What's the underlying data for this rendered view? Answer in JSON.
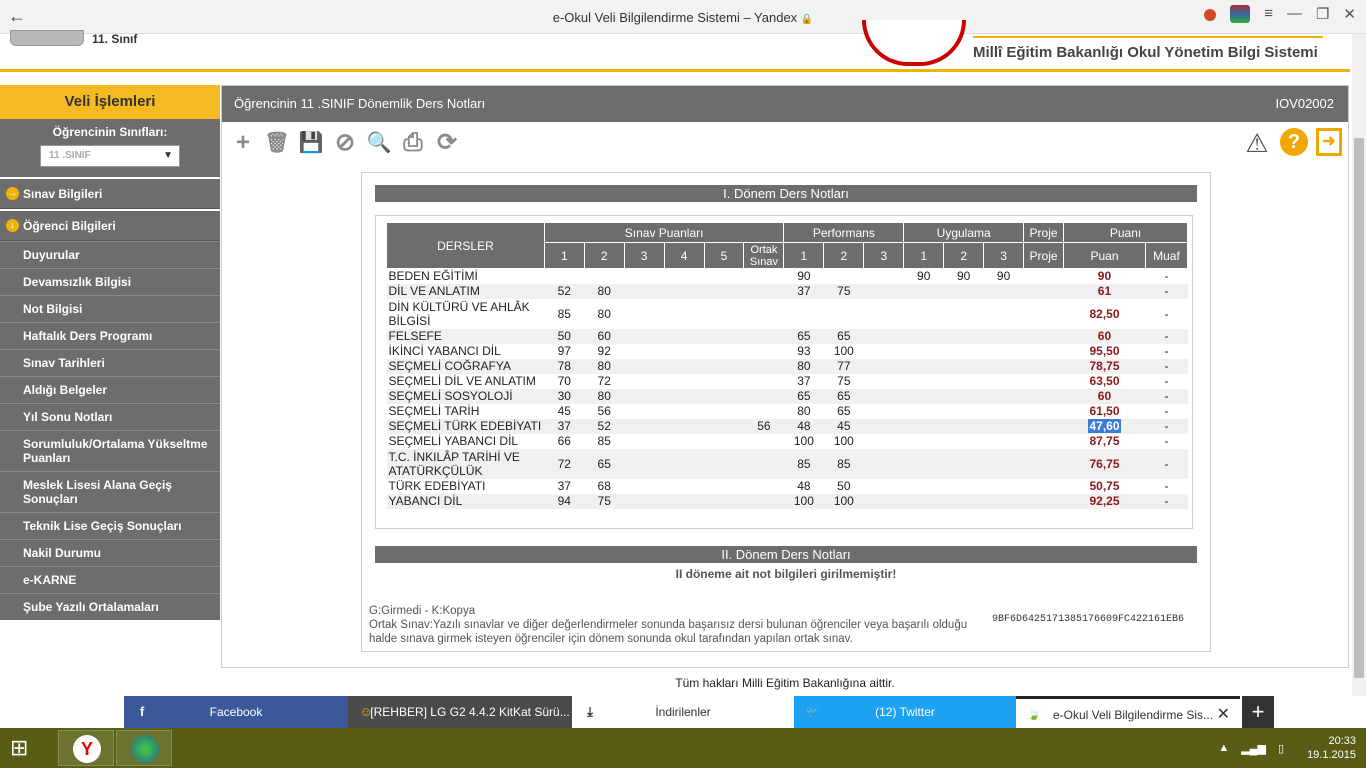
{
  "browser": {
    "back_icon": "←",
    "title": "e-Okul Veli Bilgilendirme Sistemi – Yandex",
    "lock_icon": "🔒",
    "menu_icon": "≡",
    "minimize_icon": "—",
    "restore_icon": "❐",
    "close_icon": "✕"
  },
  "header": {
    "class_label": "11. Sınıf",
    "ministry": "Millî Eğitim Bakanlığı Okul Yönetim Bilgi Sistemi"
  },
  "sidebar": {
    "title": "Veli İşlemleri",
    "class_label": "Öğrencinin Sınıfları:",
    "class_select": "11 .SINIF",
    "main_items": [
      {
        "label": "Sınav Bilgileri",
        "icon": "→"
      },
      {
        "label": "Öğrenci Bilgileri",
        "icon": "↓"
      }
    ],
    "sub_items": [
      "Duyurular",
      "Devamsızlık Bilgisi",
      "Not Bilgisi",
      "Haftalık Ders Programı",
      "Sınav Tarihleri",
      "Aldığı Belgeler",
      "Yıl Sonu Notları",
      "Sorumluluk/Ortalama Yükseltme Puanları",
      "Meslek Lisesi Alana Geçiş Sonuçları",
      "Teknik Lise Geçiş Sonuçları",
      "Nakil Durumu",
      "e-KARNE",
      "Şube Yazılı Ortalamaları"
    ]
  },
  "main": {
    "title": "Öğrencinin  11 .SINIF Dönemlik Ders Notları",
    "code": "IOV02002",
    "toolbar": {
      "add": "+",
      "delete": "🗑",
      "save": "💾",
      "cancel": "⊘",
      "search": "🔍",
      "print": "⎙",
      "refresh": "⟳",
      "warning": "⚠",
      "help": "?",
      "exit": "➜"
    },
    "term1_title": "I. Dönem Ders Notları",
    "term2_title": "II. Dönem Ders Notları",
    "term2_message": "II döneme ait not bilgileri girilmemiştir!",
    "table": {
      "h_dersler": "DERSLER",
      "h_sinav": "Sınav Puanları",
      "h_performans": "Performans",
      "h_uygulama": "Uygulama",
      "h_proje": "Proje",
      "h_puani": "Puanı",
      "sub": {
        "s1": "1",
        "s2": "2",
        "s3": "3",
        "s4": "4",
        "s5": "5",
        "ortak": "Ortak Sınav",
        "p1": "1",
        "p2": "2",
        "p3": "3",
        "u1": "1",
        "u2": "2",
        "u3": "3",
        "proje": "Proje",
        "puan": "Puan",
        "muaf": "Muaf"
      },
      "rows": [
        {
          "name": "BEDEN EĞİTİMİ",
          "s1": "",
          "s2": "",
          "ortak": "",
          "p1": "90",
          "p2": "",
          "u1": "90",
          "u2": "90",
          "u3": "90",
          "puan": "90",
          "muaf": "-"
        },
        {
          "name": "DİL VE ANLATIM",
          "s1": "52",
          "s2": "80",
          "ortak": "",
          "p1": "37",
          "p2": "75",
          "u1": "",
          "u2": "",
          "u3": "",
          "puan": "61",
          "muaf": "-"
        },
        {
          "name": "DİN KÜLTÜRÜ VE AHLÂK BİLGİSİ",
          "s1": "85",
          "s2": "80",
          "ortak": "",
          "p1": "",
          "p2": "",
          "u1": "",
          "u2": "",
          "u3": "",
          "puan": "82,50",
          "muaf": "-"
        },
        {
          "name": "FELSEFE",
          "s1": "50",
          "s2": "60",
          "ortak": "",
          "p1": "65",
          "p2": "65",
          "u1": "",
          "u2": "",
          "u3": "",
          "puan": "60",
          "muaf": "-"
        },
        {
          "name": "İKİNCİ YABANCI DİL",
          "s1": "97",
          "s2": "92",
          "ortak": "",
          "p1": "93",
          "p2": "100",
          "u1": "",
          "u2": "",
          "u3": "",
          "puan": "95,50",
          "muaf": "-"
        },
        {
          "name": "SEÇMELİ COĞRAFYA",
          "s1": "78",
          "s2": "80",
          "ortak": "",
          "p1": "80",
          "p2": "77",
          "u1": "",
          "u2": "",
          "u3": "",
          "puan": "78,75",
          "muaf": "-"
        },
        {
          "name": "SEÇMELİ DİL VE ANLATIM",
          "s1": "70",
          "s2": "72",
          "ortak": "",
          "p1": "37",
          "p2": "75",
          "u1": "",
          "u2": "",
          "u3": "",
          "puan": "63,50",
          "muaf": "-"
        },
        {
          "name": "SEÇMELİ SOSYOLOJİ",
          "s1": "30",
          "s2": "80",
          "ortak": "",
          "p1": "65",
          "p2": "65",
          "u1": "",
          "u2": "",
          "u3": "",
          "puan": "60",
          "muaf": "-"
        },
        {
          "name": "SEÇMELİ TARİH",
          "s1": "45",
          "s2": "56",
          "ortak": "",
          "p1": "80",
          "p2": "65",
          "u1": "",
          "u2": "",
          "u3": "",
          "puan": "61,50",
          "muaf": "-"
        },
        {
          "name": "SEÇMELİ TÜRK EDEBİYATI",
          "s1": "37",
          "s2": "52",
          "ortak": "56",
          "p1": "48",
          "p2": "45",
          "u1": "",
          "u2": "",
          "u3": "",
          "puan": "47,60",
          "muaf": "-",
          "selected": true
        },
        {
          "name": "SEÇMELİ YABANCI DİL",
          "s1": "66",
          "s2": "85",
          "ortak": "",
          "p1": "100",
          "p2": "100",
          "u1": "",
          "u2": "",
          "u3": "",
          "puan": "87,75",
          "muaf": "-"
        },
        {
          "name": "T.C. İNKILÂP TARİHİ VE ATATÜRKÇÜLÜK",
          "s1": "72",
          "s2": "65",
          "ortak": "",
          "p1": "85",
          "p2": "85",
          "u1": "",
          "u2": "",
          "u3": "",
          "puan": "76,75",
          "muaf": "-"
        },
        {
          "name": "TÜRK EDEBİYATI",
          "s1": "37",
          "s2": "68",
          "ortak": "",
          "p1": "48",
          "p2": "50",
          "u1": "",
          "u2": "",
          "u3": "",
          "puan": "50,75",
          "muaf": "-"
        },
        {
          "name": "YABANCI DİL",
          "s1": "94",
          "s2": "75",
          "ortak": "",
          "p1": "100",
          "p2": "100",
          "u1": "",
          "u2": "",
          "u3": "",
          "puan": "92,25",
          "muaf": "-"
        }
      ]
    },
    "legend": "G:Girmedi - K:Kopya",
    "ortak_note": "Ortak Sınav:Yazılı sınavlar ve diğer değerlendirmeler sonunda başarısız dersi bulunan öğrenciler veya başarılı olduğu halde sınava girmek isteyen öğrenciler için dönem sonunda okul tarafından yapılan ortak sınav.",
    "hash": "9BF6D6425171385176609FC422161EB6"
  },
  "footer": "Tüm hakları Milli Eğitim Bakanlığına aittir.",
  "tabs": [
    {
      "label": "Facebook",
      "icon": "f"
    },
    {
      "label": "[REHBER] LG G2 4.4.2 KitKat Sürü...",
      "icon": "☺"
    },
    {
      "label": "İndirilenler",
      "icon": "⤓"
    },
    {
      "label": "(12) Twitter",
      "icon": "🐦"
    },
    {
      "label": "e-Okul Veli Bilgilendirme Sis...",
      "icon": "🍃",
      "close": "✕"
    }
  ],
  "new_tab": "+",
  "taskbar": {
    "start_icon": "⊞",
    "yandex_icon": "Y",
    "time": "20:33",
    "date": "19.1.2015",
    "tray_arrow": "▲"
  },
  "colors": {
    "accent_yellow": "#f5b921",
    "panel_grey": "#6d6d6d",
    "score_red": "#8b1a1a",
    "facebook": "#3b5998",
    "twitter": "#1da1f2",
    "taskbar": "#585c15"
  }
}
